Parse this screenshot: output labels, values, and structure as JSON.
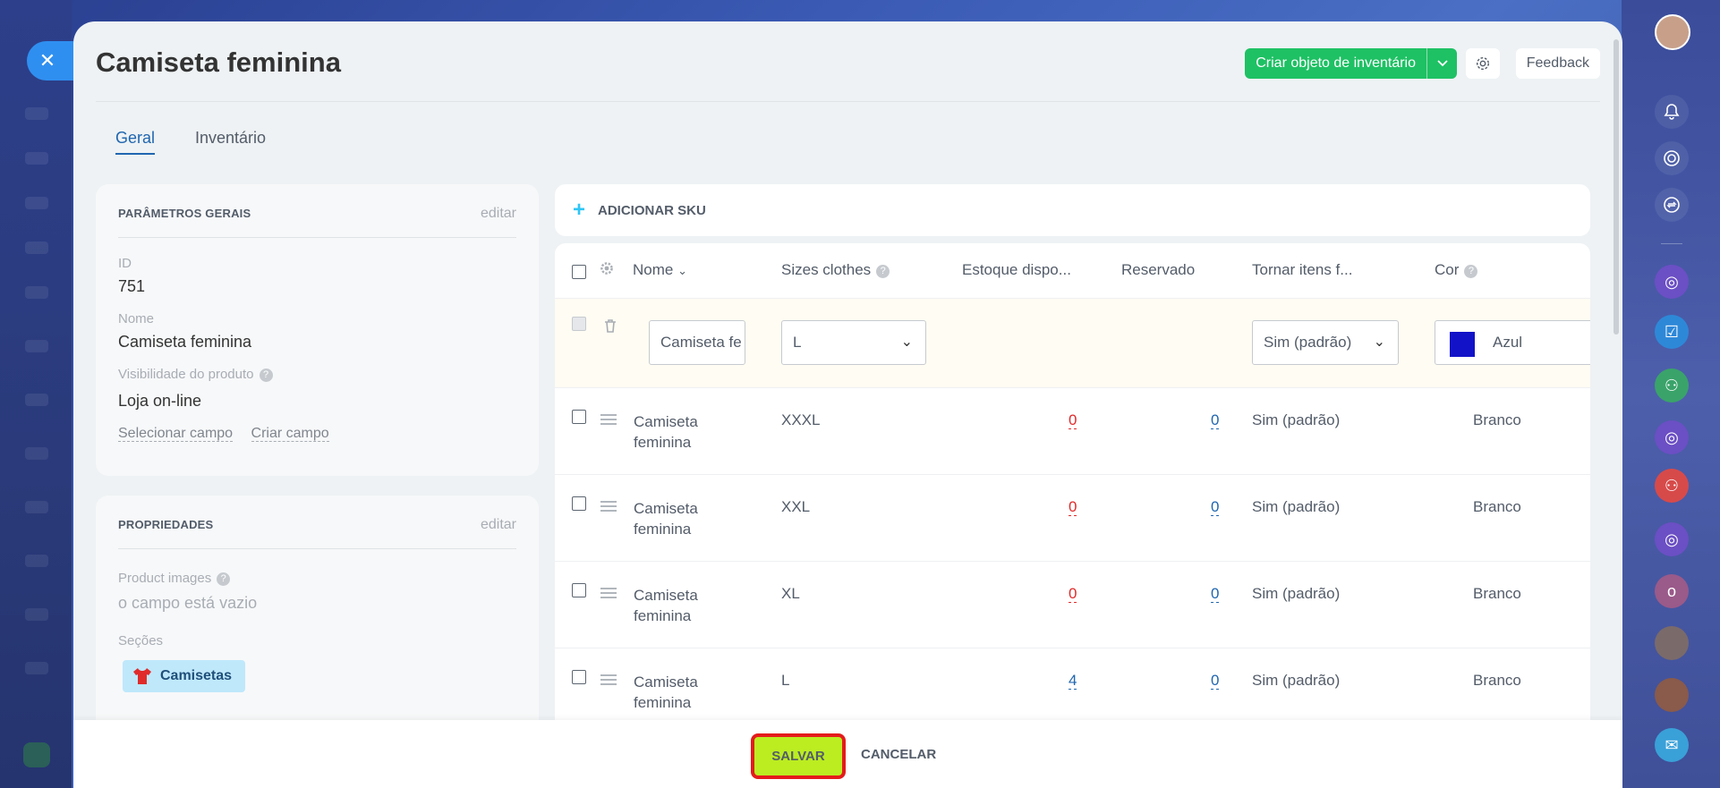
{
  "header": {
    "title": "Camiseta feminina",
    "create_label": "Criar objeto de inventário",
    "feedback_label": "Feedback"
  },
  "tabs": [
    {
      "label": "Geral",
      "active": true
    },
    {
      "label": "Inventário",
      "active": false
    }
  ],
  "general": {
    "title": "PARÂMETROS GERAIS",
    "edit": "editar",
    "id_label": "ID",
    "id_value": "751",
    "name_label": "Nome",
    "name_value": "Camiseta feminina",
    "visibility_label": "Visibilidade do produto",
    "visibility_value": "Loja on-line",
    "select_field": "Selecionar campo",
    "create_field": "Criar campo"
  },
  "properties": {
    "title": "PROPRIEDADES",
    "edit": "editar",
    "images_label": "Product images",
    "images_value": "o campo está vazio",
    "sections_label": "Seções",
    "section_chip": "Camisetas"
  },
  "sku": {
    "add_label": "ADICIONAR SKU",
    "columns": {
      "name": "Nome",
      "sizes": "Sizes clothes",
      "stock": "Estoque dispo...",
      "reserved": "Reservado",
      "make": "Tornar itens f...",
      "color": "Cor"
    },
    "edit_row": {
      "name": "Camiseta fe",
      "size": "L",
      "make": "Sim (padrão)",
      "color": "Azul",
      "color_hex": "#1212c8"
    },
    "rows": [
      {
        "name1": "Camiseta",
        "name2": "feminina",
        "size": "XXXL",
        "stock": "0",
        "reserved": "0",
        "make": "Sim (padrão)",
        "color": "Branco"
      },
      {
        "name1": "Camiseta",
        "name2": "feminina",
        "size": "XXL",
        "stock": "0",
        "reserved": "0",
        "make": "Sim (padrão)",
        "color": "Branco"
      },
      {
        "name1": "Camiseta",
        "name2": "feminina",
        "size": "XL",
        "stock": "0",
        "reserved": "0",
        "make": "Sim (padrão)",
        "color": "Branco"
      },
      {
        "name1": "Camiseta",
        "name2": "feminina",
        "size": "L",
        "stock": "4",
        "reserved": "0",
        "make": "Sim (padrão)",
        "color": "Branco"
      }
    ]
  },
  "footer": {
    "save": "SALVAR",
    "cancel": "CANCELAR"
  },
  "colors": {
    "accent_green": "#1ec164",
    "save_green": "#bbed21",
    "link_blue": "#2066b0",
    "stock_red": "#e02b2b"
  }
}
